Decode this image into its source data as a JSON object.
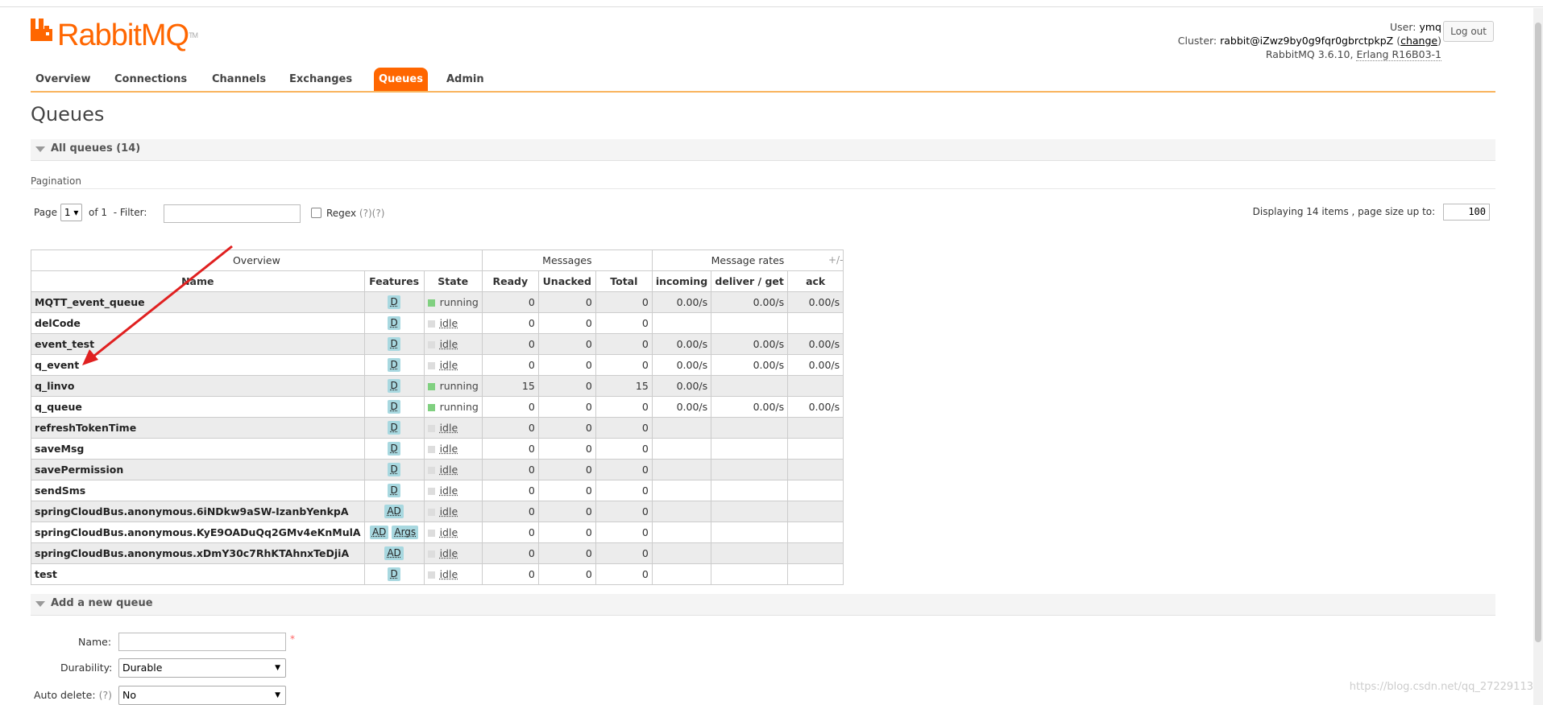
{
  "app": {
    "brand": "RabbitMQ",
    "brand_tm": "TM"
  },
  "header": {
    "user_label": "User:",
    "user": "ymq",
    "cluster_label": "Cluster:",
    "cluster": "rabbit@iZwz9by0g9fqr0gbrctpkpZ",
    "change_link": "change",
    "version": "RabbitMQ 3.6.10,",
    "erlang": "Erlang R16B03-1",
    "logout": "Log out"
  },
  "nav": {
    "tabs": [
      {
        "label": "Overview",
        "active": false
      },
      {
        "label": "Connections",
        "active": false
      },
      {
        "label": "Channels",
        "active": false
      },
      {
        "label": "Exchanges",
        "active": false
      },
      {
        "label": "Queues",
        "active": true
      },
      {
        "label": "Admin",
        "active": false
      }
    ]
  },
  "page": {
    "title": "Queues",
    "all_queues_title": "All queues (14)",
    "pagination_label": "Pagination",
    "page_label": "Page",
    "page_value": "1",
    "of_label": "of",
    "of_value": "1",
    "filter_label": "- Filter:",
    "filter_value": "",
    "regex_label": "Regex",
    "regex_help": "(?)(?)",
    "displaying": "Displaying 14 items , page size up to:",
    "page_size": "100"
  },
  "table": {
    "group_headers": [
      "Overview",
      "Messages",
      "Message rates"
    ],
    "columns": [
      "Name",
      "Features",
      "State",
      "Ready",
      "Unacked",
      "Total",
      "incoming",
      "deliver / get",
      "ack"
    ],
    "plus_minus": "+/-",
    "rows": [
      {
        "name": "MQTT_event_queue",
        "features": [
          "D"
        ],
        "state": "running",
        "ready": "0",
        "unacked": "0",
        "total": "0",
        "incoming": "0.00/s",
        "deliver": "0.00/s",
        "ack": "0.00/s"
      },
      {
        "name": "delCode",
        "features": [
          "D"
        ],
        "state": "idle",
        "ready": "0",
        "unacked": "0",
        "total": "0",
        "incoming": "",
        "deliver": "",
        "ack": ""
      },
      {
        "name": "event_test",
        "features": [
          "D"
        ],
        "state": "idle",
        "ready": "0",
        "unacked": "0",
        "total": "0",
        "incoming": "0.00/s",
        "deliver": "0.00/s",
        "ack": "0.00/s"
      },
      {
        "name": "q_event",
        "features": [
          "D"
        ],
        "state": "idle",
        "ready": "0",
        "unacked": "0",
        "total": "0",
        "incoming": "0.00/s",
        "deliver": "0.00/s",
        "ack": "0.00/s"
      },
      {
        "name": "q_linvo",
        "features": [
          "D"
        ],
        "state": "running",
        "ready": "15",
        "unacked": "0",
        "total": "15",
        "incoming": "0.00/s",
        "deliver": "",
        "ack": ""
      },
      {
        "name": "q_queue",
        "features": [
          "D"
        ],
        "state": "running",
        "ready": "0",
        "unacked": "0",
        "total": "0",
        "incoming": "0.00/s",
        "deliver": "0.00/s",
        "ack": "0.00/s"
      },
      {
        "name": "refreshTokenTime",
        "features": [
          "D"
        ],
        "state": "idle",
        "ready": "0",
        "unacked": "0",
        "total": "0",
        "incoming": "",
        "deliver": "",
        "ack": ""
      },
      {
        "name": "saveMsg",
        "features": [
          "D"
        ],
        "state": "idle",
        "ready": "0",
        "unacked": "0",
        "total": "0",
        "incoming": "",
        "deliver": "",
        "ack": ""
      },
      {
        "name": "savePermission",
        "features": [
          "D"
        ],
        "state": "idle",
        "ready": "0",
        "unacked": "0",
        "total": "0",
        "incoming": "",
        "deliver": "",
        "ack": ""
      },
      {
        "name": "sendSms",
        "features": [
          "D"
        ],
        "state": "idle",
        "ready": "0",
        "unacked": "0",
        "total": "0",
        "incoming": "",
        "deliver": "",
        "ack": ""
      },
      {
        "name": "springCloudBus.anonymous.6iNDkw9aSW-IzanbYenkpA",
        "features": [
          "AD"
        ],
        "state": "idle",
        "ready": "0",
        "unacked": "0",
        "total": "0",
        "incoming": "",
        "deliver": "",
        "ack": ""
      },
      {
        "name": "springCloudBus.anonymous.KyE9OADuQq2GMv4eKnMulA",
        "features": [
          "AD",
          "Args"
        ],
        "state": "idle",
        "ready": "0",
        "unacked": "0",
        "total": "0",
        "incoming": "",
        "deliver": "",
        "ack": ""
      },
      {
        "name": "springCloudBus.anonymous.xDmY30c7RhKTAhnxTeDjiA",
        "features": [
          "AD"
        ],
        "state": "idle",
        "ready": "0",
        "unacked": "0",
        "total": "0",
        "incoming": "",
        "deliver": "",
        "ack": ""
      },
      {
        "name": "test",
        "features": [
          "D"
        ],
        "state": "idle",
        "ready": "0",
        "unacked": "0",
        "total": "0",
        "incoming": "",
        "deliver": "",
        "ack": ""
      }
    ]
  },
  "add_queue": {
    "title": "Add a new queue",
    "name_label": "Name:",
    "name_value": "",
    "required_mark": "*",
    "durability_label": "Durability:",
    "durability_value": "Durable",
    "auto_delete_label": "Auto delete:",
    "auto_delete_help": "(?)",
    "auto_delete_value": "No"
  },
  "watermark": "https://blog.csdn.net/qq_27229113",
  "colors": {
    "brand": "#ff6600",
    "tab_underline": "#f9b45d",
    "feature_badge": "#a8d8e0",
    "running": "#80d080",
    "idle": "#dddddd",
    "annotation_arrow": "#e02020"
  }
}
